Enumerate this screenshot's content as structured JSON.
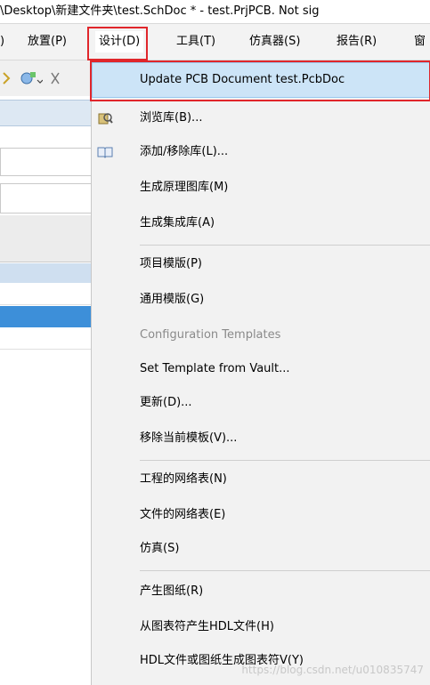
{
  "title": "\\Desktop\\新建文件夹\\test.SchDoc * - test.PrjPCB. Not sig",
  "menubar": {
    "items": [
      {
        "label": ")",
        "id": "fragment"
      },
      {
        "label": "放置(P)",
        "id": "place"
      },
      {
        "label": "设计(D)",
        "id": "design"
      },
      {
        "label": "工具(T)",
        "id": "tools"
      },
      {
        "label": "仿真器(S)",
        "id": "simulator"
      },
      {
        "label": "报告(R)",
        "id": "reports"
      },
      {
        "label": "窗",
        "id": "window"
      }
    ]
  },
  "dropdown": {
    "items": [
      {
        "label": "Update PCB Document test.PcbDoc",
        "highlighted": true
      },
      {
        "label": "浏览库(B)...",
        "icon": "browse-library-icon"
      },
      {
        "label": "添加/移除库(L)...",
        "icon": "book-icon"
      },
      {
        "label": "生成原理图库(M)"
      },
      {
        "label": "生成集成库(A)"
      },
      {
        "label": "项目模版(P)"
      },
      {
        "label": "通用模版(G)"
      },
      {
        "label": "Configuration Templates",
        "disabled": true
      },
      {
        "label": "Set Template from Vault..."
      },
      {
        "label": "更新(D)..."
      },
      {
        "label": "移除当前模板(V)..."
      },
      {
        "label": "工程的网络表(N)"
      },
      {
        "label": "文件的网络表(E)"
      },
      {
        "label": "仿真(S)"
      },
      {
        "label": "产生图纸(R)"
      },
      {
        "label": "从图表符产生HDL文件(H)"
      },
      {
        "label": "HDL文件或图纸生成图表符V(Y)"
      }
    ]
  },
  "watermark": "https://blog.csdn.net/u010835747",
  "colors": {
    "highlight": "#cce4f7",
    "annotation_red": "#e0262b",
    "selected_row": "#3d8fd9"
  }
}
